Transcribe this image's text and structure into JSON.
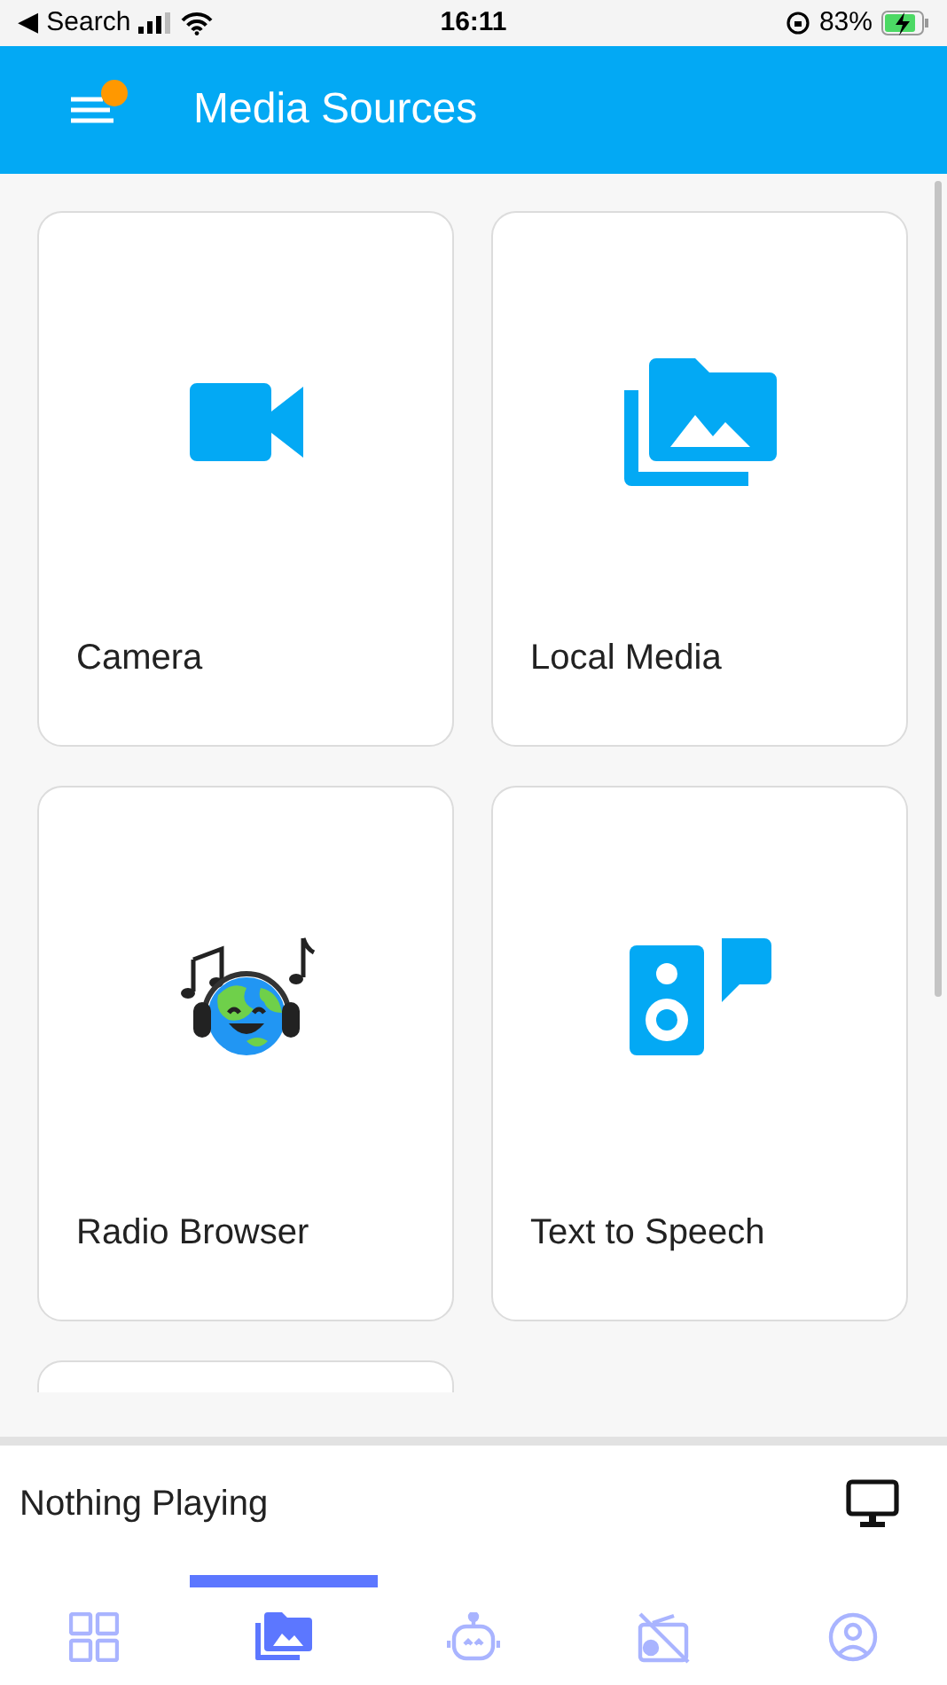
{
  "status_bar": {
    "back_label": "◀ Search",
    "time": "16:11",
    "battery": "83%"
  },
  "header": {
    "title": "Media Sources",
    "notification_dot": true
  },
  "cards": [
    {
      "kind": "camera",
      "label": "Camera"
    },
    {
      "kind": "folder",
      "label": "Local Media"
    },
    {
      "kind": "radio",
      "label": "Radio Browser"
    },
    {
      "kind": "speech",
      "label": "Text to Speech"
    },
    {
      "kind": "partial"
    }
  ],
  "player": {
    "status": "Nothing Playing"
  },
  "nav": [
    {
      "kind": "grid",
      "selected": false
    },
    {
      "kind": "media",
      "selected": true
    },
    {
      "kind": "robot",
      "selected": false
    },
    {
      "kind": "radio-off",
      "selected": false
    },
    {
      "kind": "profile",
      "selected": false
    }
  ]
}
